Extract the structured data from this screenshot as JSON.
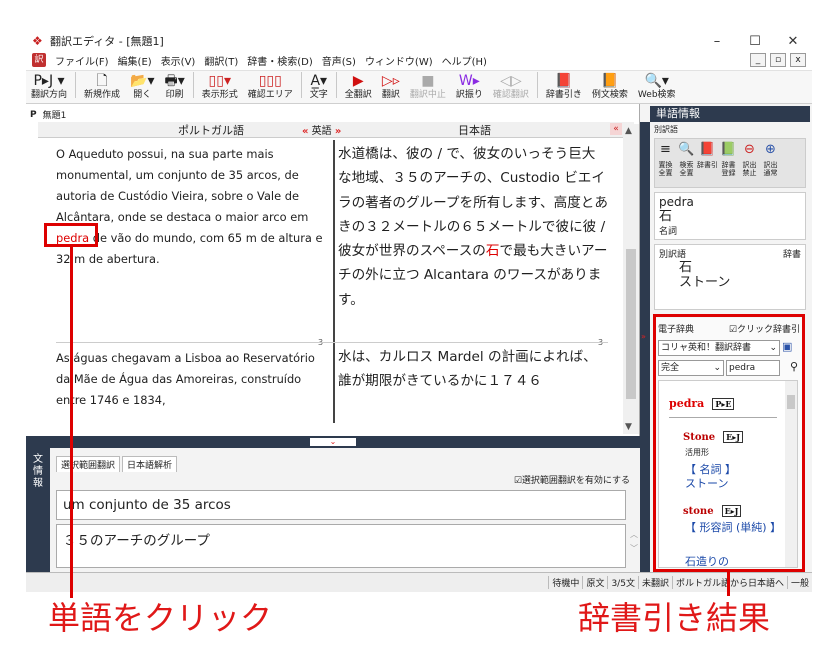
{
  "window": {
    "title": "翻訳エディタ - [無題1]",
    "min": "–",
    "max": "☐",
    "close": "✕"
  },
  "menu": [
    "ファイル(F)",
    "編集(E)",
    "表示(V)",
    "翻訳(T)",
    "辞書・検索(D)",
    "音声(S)",
    "ウィンドウ(W)",
    "ヘルプ(H)"
  ],
  "toolbar": {
    "buttons": [
      {
        "glyph": "P▸J ▾",
        "label": "翻訳方向"
      },
      {
        "glyph": "🗋",
        "label": "新規作成"
      },
      {
        "glyph": "📂▾",
        "label": "開く"
      },
      {
        "glyph": "🖶▾",
        "label": "印刷"
      },
      {
        "glyph": "▯▯▾",
        "label": "表示形式"
      },
      {
        "glyph": "▯▯▯",
        "label": "確認エリア"
      },
      {
        "glyph": "A̲▾",
        "label": "文字"
      },
      {
        "glyph": "▶",
        "label": "全翻訳"
      },
      {
        "glyph": "▷▹",
        "label": "翻訳"
      },
      {
        "glyph": "■",
        "label": "翻訳中止",
        "disabled": true
      },
      {
        "glyph": "W▸",
        "label": "訳振り"
      },
      {
        "glyph": "◁▷",
        "label": "確認翻訳",
        "disabled": true
      },
      {
        "glyph": "📕",
        "label": "辞書引き"
      },
      {
        "glyph": "📙",
        "label": "例文検索"
      },
      {
        "glyph": "🔍▾",
        "label": "Web検索"
      }
    ]
  },
  "document": {
    "tab_label": "P",
    "tab_name": "無題1",
    "source_lang": "ポルトガル語",
    "direction_left": "«",
    "direction_mid": "英語",
    "direction_right": "»",
    "target_lang": "日本語",
    "seg1": {
      "src_before": "O Aqueduto possui, na sua parte mais monumental, um conjunto de 35 arcos, de autoria de Custódio Vieira, sobre o Vale de Alcântara, onde se destaca o maior arco em ",
      "src_word": "pedra",
      "src_after": " de vão do mundo, com 65 m de altura e 32 m de abertura.",
      "tgt_before": "水道橋は、彼の / で、彼女のいっそう巨大な地域、３５のアーチの、Custodio ビエイラの著者のグループを所有します、高度とあきの３２メートルの６５メートルで彼に彼 / 彼女が世界のスペースの",
      "tgt_word": "石",
      "tgt_after": "で最も大きいアーチの外に立つ Alcantara のワースがあります。",
      "num": "3"
    },
    "seg2": {
      "src": "As águas chegavam a Lisboa ao Reservatório da Mãe de Água das Amoreiras, construído entre 1746 e 1834,",
      "tgt": "水は、カルロス Mardel の計画によれば、誰が期限がきているかに１７４６"
    }
  },
  "bottom": {
    "side_label": "文\n情\n報",
    "tab1": "選択範囲翻訳",
    "tab2": "日本語解析",
    "checkbox": "☑選択範囲翻訳を有効にする",
    "src": "um conjunto de 35 arcos",
    "tgt": "３５のアーチのグループ"
  },
  "status": [
    "待機中",
    "原文",
    "3/5文",
    "未翻訳",
    "ポルトガル語から日本語へ",
    "一般"
  ],
  "word_info": {
    "header": "単語情報",
    "sub": "別訳語",
    "tools": [
      {
        "icon": "≡",
        "label": "置換\n全置"
      },
      {
        "icon": "🔍",
        "label": "検索\n全置"
      },
      {
        "icon": "📕",
        "label": "辞書引"
      },
      {
        "icon": "📗",
        "label": "辞書\n登録"
      },
      {
        "icon": "⊖",
        "label": "訳出\n禁止"
      },
      {
        "icon": "⊕",
        "label": "訳出\n通常"
      }
    ],
    "word": "pedra",
    "word_tr": "石",
    "pos": "名詞",
    "list_hdr_left": "別訳語",
    "list_hdr_right": "辞書",
    "items": [
      "石",
      "ストーン"
    ]
  },
  "edict": {
    "title": "電子辞典",
    "check": "☑クリック辞書引",
    "dict": "コリャ英和！翻訳辞書",
    "mode": "完全",
    "query": "pedra",
    "headword": "pedra",
    "headtag": "P▸E",
    "e1": "Stone",
    "e1tag": "E▸J",
    "e1pos": "活用形",
    "e1cat": "【 名詞 】",
    "e1tr": "ストーン",
    "e2": "stone",
    "e2tag": "E▸J",
    "e2cat": "【 形容詞 (単純) 】",
    "e2tr": "石造りの"
  },
  "annotations": {
    "left": "単語をクリック",
    "right": "辞書引き結果"
  }
}
